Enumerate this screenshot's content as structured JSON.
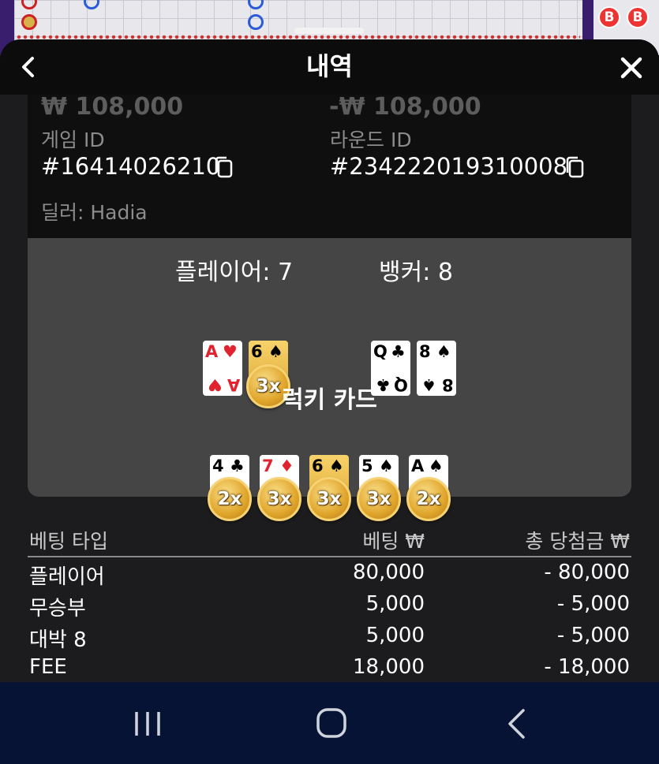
{
  "header": {
    "title": "내역"
  },
  "info": {
    "faded_amount_left": "₩ 108,000",
    "faded_amount_right": "-₩ 108,000",
    "game_id_label": "게임 ID",
    "game_id_value": "#16414026210",
    "round_id_label": "라운드 ID",
    "round_id_value": "#234222019310008",
    "dealer": "딜러: Hadia"
  },
  "result": {
    "player_label": "플레이어: 7",
    "banker_label": "뱅커: 8",
    "player_cards": [
      {
        "rank": "A",
        "suit": "♥",
        "color": "red",
        "gold": false
      },
      {
        "rank": "6",
        "suit": "♠",
        "color": "black",
        "gold": true,
        "multiplier": "3x"
      }
    ],
    "banker_cards": [
      {
        "rank": "Q",
        "suit": "♣",
        "color": "black",
        "gold": false
      },
      {
        "rank": "8",
        "suit": "♠",
        "color": "black",
        "gold": false
      }
    ],
    "lucky_title": "럭키 카드",
    "lucky_cards": [
      {
        "rank": "4",
        "suit": "♣",
        "color": "black",
        "gold": false,
        "multiplier": "2x"
      },
      {
        "rank": "7",
        "suit": "♦",
        "color": "red",
        "gold": false,
        "multiplier": "3x"
      },
      {
        "rank": "6",
        "suit": "♠",
        "color": "black",
        "gold": true,
        "multiplier": "3x"
      },
      {
        "rank": "5",
        "suit": "♠",
        "color": "black",
        "gold": false,
        "multiplier": "3x"
      },
      {
        "rank": "A",
        "suit": "♠",
        "color": "black",
        "gold": false,
        "multiplier": "2x"
      }
    ]
  },
  "bets": {
    "headers": [
      "베팅 타입",
      "베팅 ₩",
      "총 당첨금 ₩"
    ],
    "rows": [
      [
        "플레이어",
        "80,000",
        "- 80,000"
      ],
      [
        "무승부",
        "5,000",
        "- 5,000"
      ],
      [
        "대박 8",
        "5,000",
        "- 5,000"
      ],
      [
        "FEE",
        "18,000",
        "- 18,000"
      ]
    ]
  },
  "background_board": {
    "badge_letter": "B"
  },
  "colors": {
    "accent_gold": "#e0a935",
    "card_red": "#e0232e",
    "nav_bg": "#061334"
  },
  "icons": [
    "back-chevron-icon",
    "close-x-icon",
    "copy-icon",
    "recent-apps-icon",
    "home-icon",
    "nav-back-icon"
  ]
}
